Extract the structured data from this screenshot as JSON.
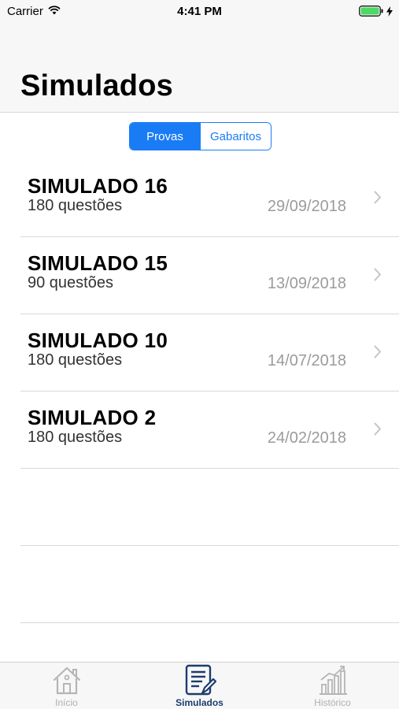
{
  "status_bar": {
    "carrier": "Carrier",
    "time": "4:41 PM"
  },
  "header": {
    "title": "Simulados"
  },
  "segmented_control": {
    "options": [
      "Provas",
      "Gabaritos"
    ],
    "selected": "Provas"
  },
  "simulados": [
    {
      "title": "SIMULADO 16",
      "questions": "180 questões",
      "date": "29/09/2018"
    },
    {
      "title": "SIMULADO 15",
      "questions": "90 questões",
      "date": "13/09/2018"
    },
    {
      "title": "SIMULADO 10",
      "questions": "180 questões",
      "date": "14/07/2018"
    },
    {
      "title": "SIMULADO 2",
      "questions": "180 questões",
      "date": "24/02/2018"
    }
  ],
  "tab_bar": {
    "tabs": [
      {
        "label": "Início",
        "icon": "house-icon"
      },
      {
        "label": "Simulados",
        "icon": "document-edit-icon"
      },
      {
        "label": "Histórico",
        "icon": "bar-chart-icon"
      }
    ],
    "selected": "Simulados"
  },
  "colors": {
    "accent": "#1a7cf5",
    "tab_active": "#1d3c6e",
    "tab_inactive": "#b0b0b0",
    "date_text": "#9b9b9b"
  }
}
